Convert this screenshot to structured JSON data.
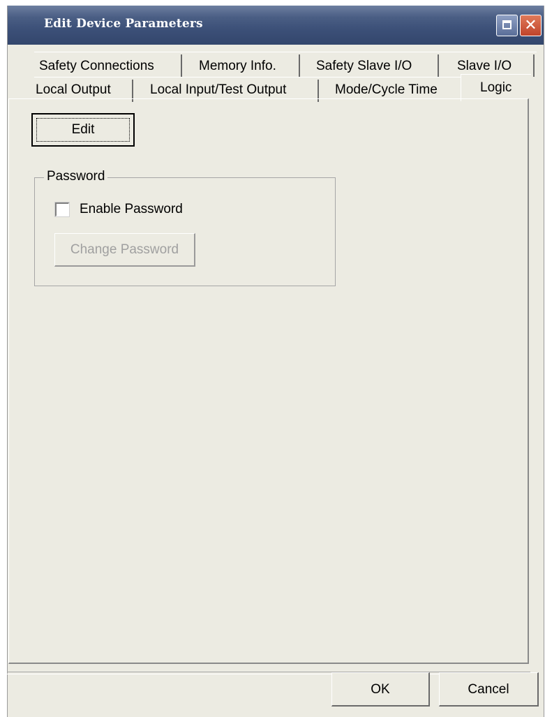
{
  "window": {
    "title": "Edit Device Parameters"
  },
  "tabs": {
    "row1": [
      "Safety Connections",
      "Memory Info.",
      "Safety Slave I/O",
      "Slave I/O"
    ],
    "row2": [
      "Local Output",
      "Local Input/Test Output",
      "Mode/Cycle Time",
      "Logic"
    ],
    "selected": "Logic"
  },
  "logic_page": {
    "edit_label": "Edit",
    "password_group": {
      "legend": "Password",
      "enable_label": "Enable Password",
      "enable_checked": false,
      "change_label": "Change Password",
      "change_enabled": false
    }
  },
  "footer": {
    "ok_label": "OK",
    "cancel_label": "Cancel"
  },
  "icons": {
    "maximize": "maximize-icon",
    "close": "close-icon"
  }
}
